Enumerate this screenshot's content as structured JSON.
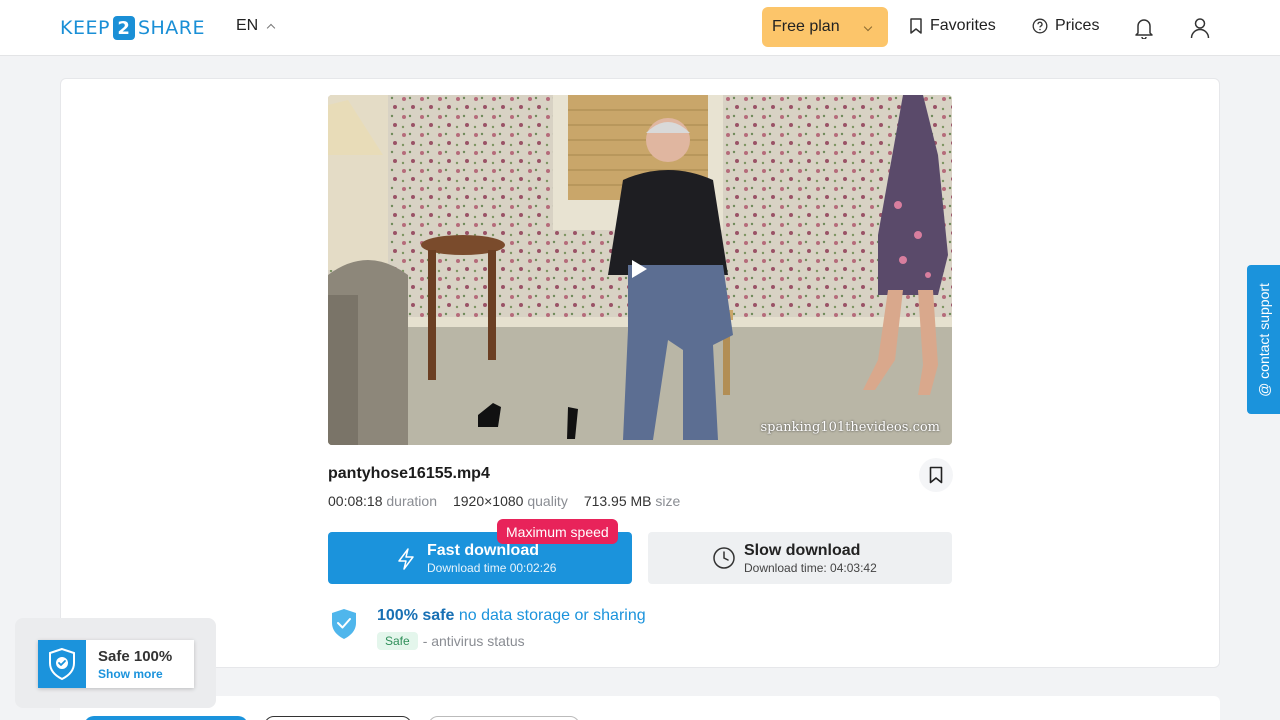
{
  "header": {
    "logo": {
      "left": "KEEP",
      "number": "2",
      "right": "SHARE"
    },
    "language": "EN",
    "plan_button": "Free plan",
    "favorites": "Favorites",
    "prices": "Prices",
    "icons": [
      "bookmark-icon",
      "help-circle-icon",
      "bell-icon",
      "user-icon"
    ]
  },
  "video": {
    "watermark": "spanking101thevideos.com"
  },
  "file": {
    "name": "pantyhose16155.mp4",
    "duration": "00:08:18",
    "duration_label": "duration",
    "resolution": "1920×1080",
    "resolution_label": "quality",
    "size": "713.95 MB",
    "size_label": "size"
  },
  "downloads": {
    "fast_title": "Fast download",
    "fast_sub": "Download time 00:02:26",
    "fast_badge": "Maximum speed",
    "slow_title": "Slow download",
    "slow_sub": "Download time: 04:03:42"
  },
  "safety": {
    "headline_bold": "100% safe",
    "headline_rest": "no data storage or sharing",
    "chip": "Safe",
    "status_text": "- antivirus status"
  },
  "support_tab": "@ contact support",
  "safe_widget": {
    "title": "Safe 100%",
    "link": "Show more"
  },
  "colors": {
    "accent": "#1b93dc",
    "plan": "#fcc56a",
    "badge": "#e8235a"
  }
}
